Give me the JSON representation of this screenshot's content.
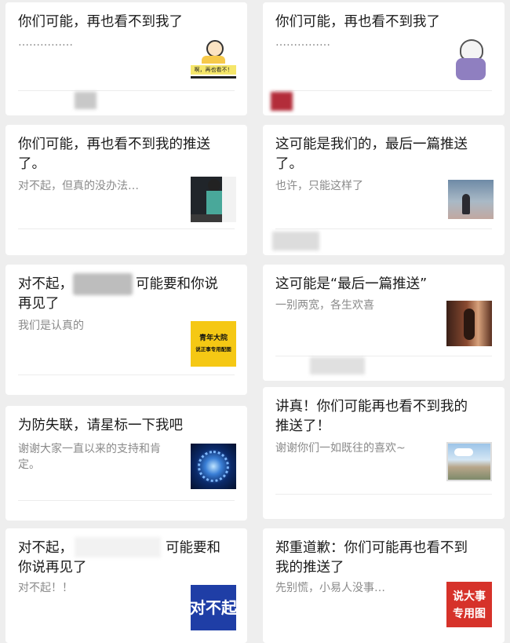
{
  "cards": [
    {
      "title_lines": [
        "你们可能，再也看不到我了"
      ],
      "sub": "……………"
    },
    {
      "title_lines": [
        "你们可能，再也看不到我了"
      ],
      "sub": "……………"
    },
    {
      "title_lines": [
        "你们可能，再也看不到我的推送",
        "了。"
      ],
      "sub": "对不起，但真的没办法…"
    },
    {
      "title_lines": [
        "这可能是我们的，最后一篇推送",
        "了。"
      ],
      "sub": "也许，只能这样了"
    },
    {
      "title_lines": [
        "对不起，",
        "可能要和你说",
        "再见了"
      ],
      "sub": "我们是认真的"
    },
    {
      "title_lines": [
        "这可能是“最后一篇推送”"
      ],
      "sub": "一别两宽，各生欢喜"
    },
    {
      "title_lines": [
        "为防失联，请星标一下我吧"
      ],
      "sub_lines": [
        "谢谢大家一直以来的支持和肯",
        "定。"
      ]
    },
    {
      "title_lines": [
        "讲真！你们可能再也看不到我的",
        "推送了！"
      ],
      "sub": "谢谢你们一如既往的喜欢~"
    },
    {
      "title_lines": [
        "对不起，",
        "可能要和",
        "你说再见了"
      ],
      "sub": "对不起！！"
    },
    {
      "title_lines": [
        "郑重道歉：你们可能再也看不到",
        "我的推送了"
      ],
      "sub": "先别慌，小易人没事…"
    }
  ],
  "thumbs": {
    "t1_text": "啊，再也看不！",
    "t5_line1": "青年大院",
    "t5_line2": "说正事专用配图",
    "t9_text": "对不起",
    "t10_line1": "说大事",
    "t10_line2": "专用图"
  },
  "colors": {
    "yellow": "#f5c814",
    "blue_banner": "#1f3ea6",
    "red_banner": "#d6322a"
  }
}
